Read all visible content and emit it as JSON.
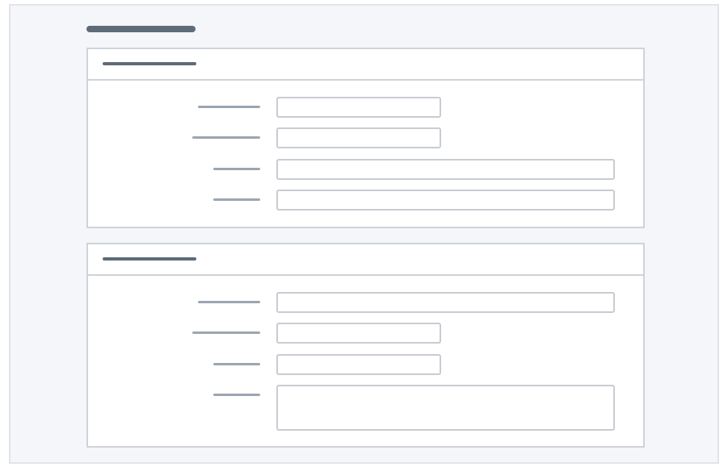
{
  "colors": {
    "page_bg": "#f4f6f9",
    "frame_border": "#e1e4e8",
    "panel_border": "#cfd3d9",
    "title_color": "#5f6b78",
    "header_bar_color": "#5f6b78",
    "label_color": "#9ca6b2",
    "input_border": "#c8ccd2"
  },
  "page": {
    "title": ""
  },
  "sections": [
    {
      "title": "",
      "fields": [
        {
          "label": "",
          "value": "",
          "kind": "text-short"
        },
        {
          "label": "",
          "value": "",
          "kind": "text-short"
        },
        {
          "label": "",
          "value": "",
          "kind": "text-long"
        },
        {
          "label": "",
          "value": "",
          "kind": "text-long"
        }
      ]
    },
    {
      "title": "",
      "fields": [
        {
          "label": "",
          "value": "",
          "kind": "text-long"
        },
        {
          "label": "",
          "value": "",
          "kind": "text-short"
        },
        {
          "label": "",
          "value": "",
          "kind": "text-short"
        },
        {
          "label": "",
          "value": "",
          "kind": "textarea"
        }
      ]
    }
  ]
}
